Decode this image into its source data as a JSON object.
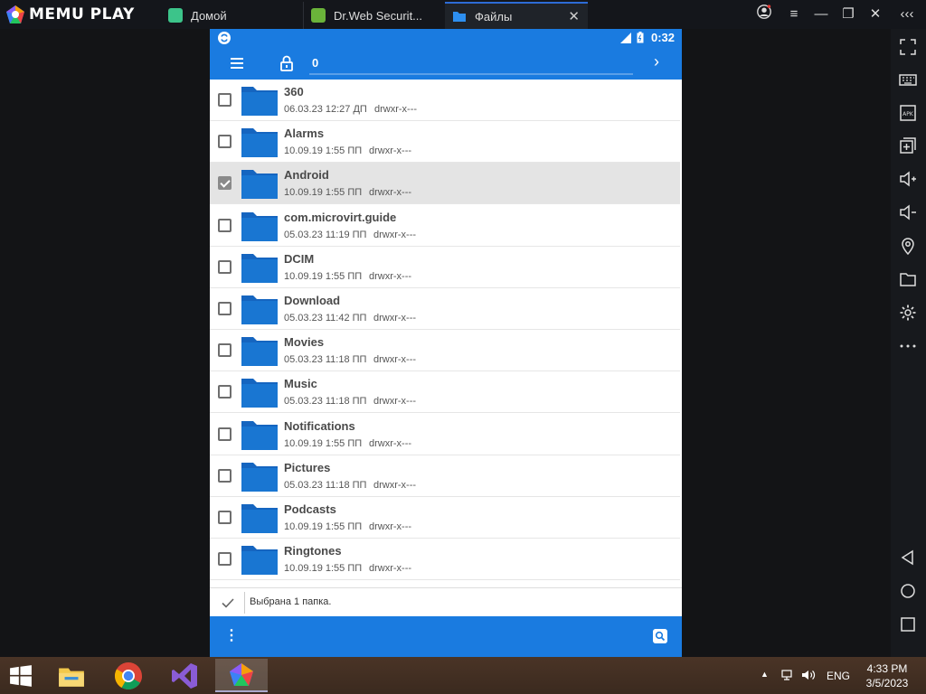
{
  "app": {
    "brand": "MEMU PLAY",
    "tabs": [
      {
        "label": "Домой",
        "icon": "home-app-icon",
        "color": "#3cc48a"
      },
      {
        "label": "Dr.Web Securit...",
        "icon": "drweb-icon",
        "color": "#6ab33a"
      },
      {
        "label": "Файлы",
        "icon": "folder-icon",
        "color": "#1a7be0"
      }
    ],
    "window_buttons": [
      "account-icon",
      "menu-icon",
      "minimize-icon",
      "restore-icon",
      "close-icon",
      "collapse-sidebar-icon"
    ]
  },
  "sidebar": {
    "items": [
      "fullscreen-icon",
      "keyboard-icon",
      "apk-icon",
      "add-window-icon",
      "volume-up-icon",
      "volume-down-icon",
      "location-icon",
      "folder-icon",
      "settings-icon",
      "more-icon",
      "back-icon",
      "home-icon",
      "recents-icon"
    ]
  },
  "android": {
    "status": {
      "time": "0:32"
    },
    "appbar": {
      "path": "0"
    },
    "files": [
      {
        "name": "360",
        "date": "06.03.23 12:27 ДП",
        "perm": "drwxr-x---",
        "selected": false
      },
      {
        "name": "Alarms",
        "date": "10.09.19 1:55 ПП",
        "perm": "drwxr-x---",
        "selected": false
      },
      {
        "name": "Android",
        "date": "10.09.19 1:55 ПП",
        "perm": "drwxr-x---",
        "selected": true
      },
      {
        "name": "com.microvirt.guide",
        "date": "05.03.23 11:19 ПП",
        "perm": "drwxr-x---",
        "selected": false
      },
      {
        "name": "DCIM",
        "date": "10.09.19 1:55 ПП",
        "perm": "drwxr-x---",
        "selected": false
      },
      {
        "name": "Download",
        "date": "05.03.23 11:42 ПП",
        "perm": "drwxr-x---",
        "selected": false
      },
      {
        "name": "Movies",
        "date": "05.03.23 11:18 ПП",
        "perm": "drwxr-x---",
        "selected": false
      },
      {
        "name": "Music",
        "date": "05.03.23 11:18 ПП",
        "perm": "drwxr-x---",
        "selected": false
      },
      {
        "name": "Notifications",
        "date": "10.09.19 1:55 ПП",
        "perm": "drwxr-x---",
        "selected": false
      },
      {
        "name": "Pictures",
        "date": "05.03.23 11:18 ПП",
        "perm": "drwxr-x---",
        "selected": false
      },
      {
        "name": "Podcasts",
        "date": "10.09.19 1:55 ПП",
        "perm": "drwxr-x---",
        "selected": false
      },
      {
        "name": "Ringtones",
        "date": "10.09.19 1:55 ПП",
        "perm": "drwxr-x---",
        "selected": false
      }
    ],
    "selection_message": "Выбрана 1 папка.",
    "accent": "#1a7be0"
  },
  "taskbar": {
    "apps": [
      "windows-start-icon",
      "file-explorer-icon",
      "chrome-icon",
      "visual-studio-icon",
      "memu-icon"
    ],
    "lang": "ENG",
    "time": "4:33 PM",
    "date": "3/5/2023"
  }
}
